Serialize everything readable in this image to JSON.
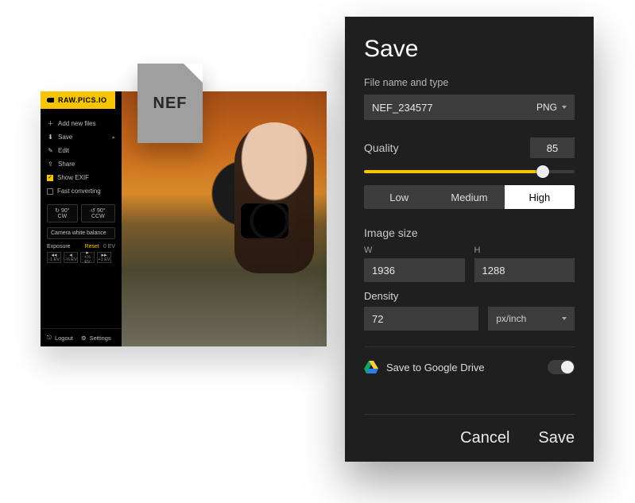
{
  "brand": "RAW.PICS.IO",
  "file_badge": "NEF",
  "sidebar": {
    "add": "Add new files",
    "save": "Save",
    "edit": "Edit",
    "share": "Share",
    "show_exif": "Show EXIF",
    "fast_converting": "Fast converting",
    "rotate_cw": "↻ 90° CW",
    "rotate_ccw": "↺ 90° CCW",
    "white_balance": "Camera white balance",
    "exposure_label": "Exposure",
    "exposure_reset": "Reset",
    "exposure_value": "0 EV",
    "ev_buttons": [
      {
        "sym": "◂◂",
        "sub": "-1 EV"
      },
      {
        "sym": "◂",
        "sub": "-⅓ EV"
      },
      {
        "sym": "▸",
        "sub": "+⅓ EV"
      },
      {
        "sym": "▸▸",
        "sub": "+1 EV"
      }
    ],
    "logout": "Logout",
    "settings": "Settings"
  },
  "dialog": {
    "title": "Save",
    "filename_label": "File name and type",
    "filename": "NEF_234577",
    "filetype": "PNG",
    "quality_label": "Quality",
    "quality_value": "85",
    "quality_pct": 85,
    "quality_options": {
      "low": "Low",
      "medium": "Medium",
      "high": "High",
      "selected": "high"
    },
    "image_size_label": "Image size",
    "w_label": "W",
    "h_label": "H",
    "width": "1936",
    "height": "1288",
    "density_label": "Density",
    "density": "72",
    "density_unit": "px/inch",
    "gdrive_label": "Save to Google Drive",
    "cancel": "Cancel",
    "save": "Save"
  }
}
